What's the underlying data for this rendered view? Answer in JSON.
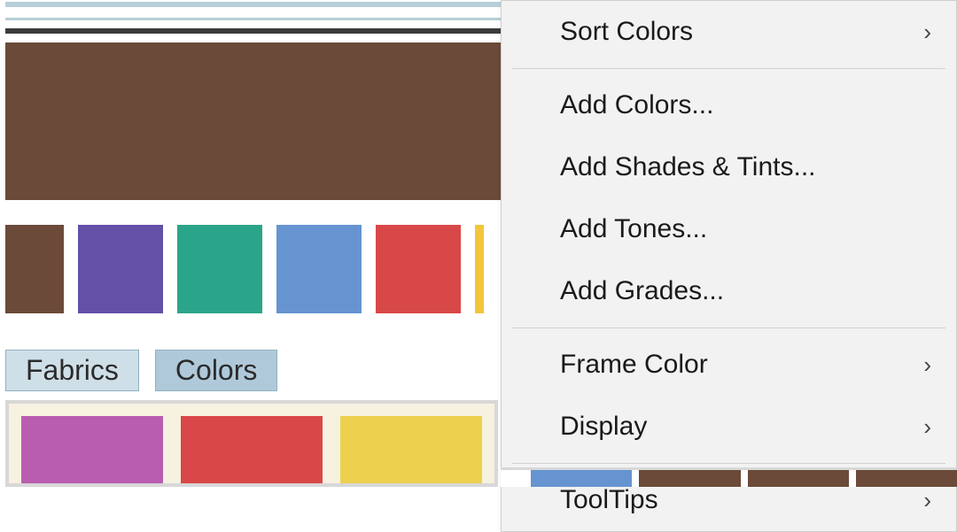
{
  "tabs": {
    "fabrics": "Fabrics",
    "colors": "Colors"
  },
  "menu": {
    "sort_colors": "Sort Colors",
    "add_colors": "Add Colors...",
    "add_shades_tints": "Add Shades & Tints...",
    "add_tones": "Add Tones...",
    "add_grades": "Add Grades...",
    "frame_color": "Frame Color",
    "display": "Display",
    "tooltips": "ToolTips"
  },
  "palette_large": "#6b4a39",
  "palette_row": [
    "#6b4a39",
    "#6350a7",
    "#2ba58a",
    "#6694d1",
    "#d94848",
    "#f2c63a"
  ],
  "bottom_chips": [
    "#b85db0",
    "#d94848",
    "#eed04f"
  ]
}
